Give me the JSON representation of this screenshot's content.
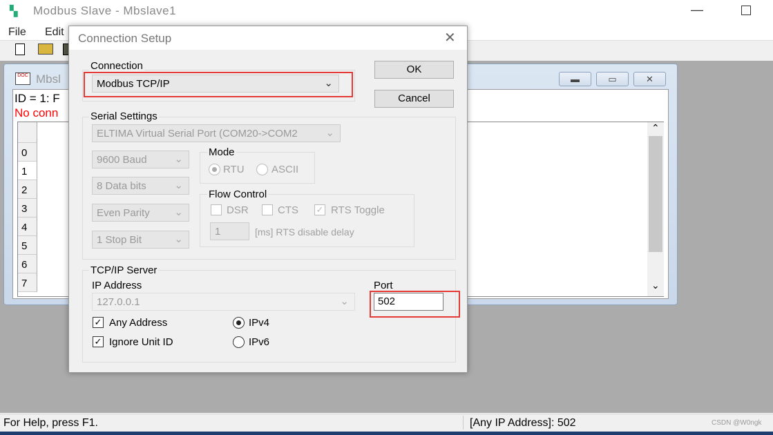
{
  "app": {
    "title": "Modbus Slave - Mbslave1",
    "menu": [
      "File",
      "Edit"
    ]
  },
  "child": {
    "title": "Mbsl",
    "id_line": "ID = 1: F",
    "status_line": "No conn",
    "rows": [
      "0",
      "1",
      "2",
      "3",
      "4",
      "5",
      "6",
      "7"
    ]
  },
  "dialog": {
    "title": "Connection Setup",
    "ok": "OK",
    "cancel": "Cancel",
    "connection": {
      "label": "Connection",
      "value": "Modbus TCP/IP"
    },
    "serial": {
      "label": "Serial Settings",
      "port": "ELTIMA Virtual Serial Port (COM20->COM2",
      "baud": "9600 Baud",
      "data_bits": "8 Data bits",
      "parity": "Even Parity",
      "stop_bits": "1 Stop Bit",
      "mode": {
        "label": "Mode",
        "rtu": "RTU",
        "ascii": "ASCII",
        "selected": "RTU"
      },
      "flow": {
        "label": "Flow Control",
        "dsr": "DSR",
        "cts": "CTS",
        "rts": "RTS Toggle",
        "rts_checked": true,
        "delay_value": "1",
        "delay_label": "[ms] RTS disable delay"
      }
    },
    "tcp": {
      "label": "TCP/IP Server",
      "ip_label": "IP Address",
      "ip_value": "127.0.0.1",
      "port_label": "Port",
      "port_value": "502",
      "any_address": "Any Address",
      "any_checked": true,
      "ignore_unit": "Ignore Unit ID",
      "ignore_checked": true,
      "ipv4": "IPv4",
      "ipv6": "IPv6",
      "ip_version": "IPv4"
    }
  },
  "status": {
    "help": "For Help, press F1.",
    "connection": "[Any IP Address]: 502",
    "watermark": "CSDN @W0ngk"
  },
  "colors": {
    "highlight": "#e53935",
    "mdi_bg": "#ababab",
    "error_text": "#ff0000"
  }
}
